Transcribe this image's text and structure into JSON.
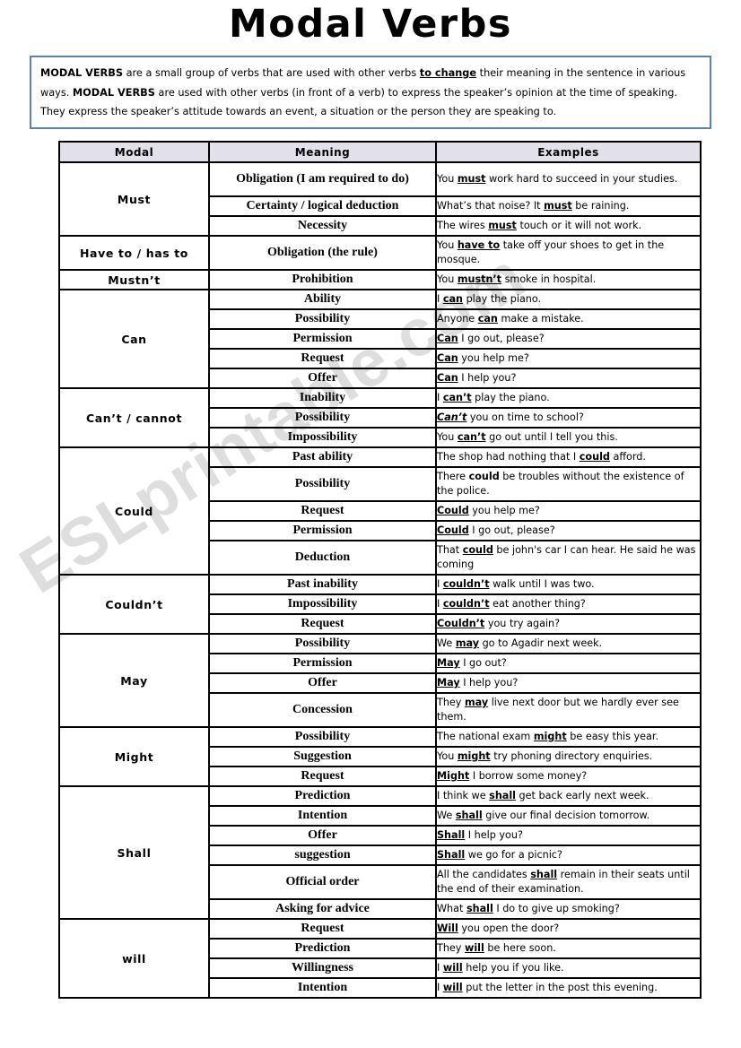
{
  "title": "Modal Verbs",
  "watermark": "ESLprintable.com",
  "intro": {
    "segments": [
      {
        "text": "MODAL VERBS",
        "style": "bold"
      },
      {
        "text": " are a small group of verbs that are used with other verbs ",
        "style": "normal"
      },
      {
        "text": "to change",
        "style": "bold-underline"
      },
      {
        "text": " their meaning in the sentence in various ways. ",
        "style": "normal"
      },
      {
        "text": "MODAL VERBS",
        "style": "bold"
      },
      {
        "text": " are used with other verbs (in front of a verb) to express the speaker’s opinion at the time of speaking. They express the speaker’s attitude towards an event, a situation or the person they are speaking to.",
        "style": "normal"
      }
    ],
    "border_color": "#5b82ab"
  },
  "table": {
    "header_bg": "#e2e0e9",
    "columns": [
      "Modal",
      "Meaning",
      "Examples"
    ],
    "groups": [
      {
        "modal": "Must",
        "rows": [
          {
            "meaning": "Obligation (I am required to do)",
            "example": [
              {
                "text": "You ",
                "style": "normal"
              },
              {
                "text": "must",
                "style": "bold-underline"
              },
              {
                "text": " work hard to succeed in your studies.",
                "style": "normal"
              }
            ],
            "lines": 2
          },
          {
            "meaning": "Certainty    /  logical deduction",
            "example": [
              {
                "text": "What’s that noise? It ",
                "style": "normal"
              },
              {
                "text": "must",
                "style": "bold-underline"
              },
              {
                "text": " be raining.",
                "style": "normal"
              }
            ],
            "lines": 1
          },
          {
            "meaning": "Necessity",
            "example": [
              {
                "text": "The wires ",
                "style": "normal"
              },
              {
                "text": "must",
                "style": "bold-underline"
              },
              {
                "text": " touch or it will not work.",
                "style": "normal"
              }
            ],
            "lines": 1
          }
        ]
      },
      {
        "modal": "Have to / has to",
        "rows": [
          {
            "meaning": "Obligation (the rule)",
            "example": [
              {
                "text": "You ",
                "style": "normal"
              },
              {
                "text": "have to",
                "style": "bold-underline"
              },
              {
                "text": " take off your shoes to get in the mosque.",
                "style": "normal"
              }
            ],
            "lines": 2
          }
        ]
      },
      {
        "modal": "Mustn’t",
        "rows": [
          {
            "meaning": "Prohibition",
            "example": [
              {
                "text": "You ",
                "style": "normal"
              },
              {
                "text": "mustn’t",
                "style": "bold-underline"
              },
              {
                "text": " smoke in hospital.",
                "style": "normal"
              }
            ],
            "lines": 1
          }
        ]
      },
      {
        "modal": "Can",
        "rows": [
          {
            "meaning": "Ability",
            "example": [
              {
                "text": "I ",
                "style": "normal"
              },
              {
                "text": "can",
                "style": "bold-underline"
              },
              {
                "text": " play the piano.",
                "style": "normal"
              }
            ],
            "lines": 1
          },
          {
            "meaning": "Possibility",
            "example": [
              {
                "text": "Anyone ",
                "style": "normal"
              },
              {
                "text": "can",
                "style": "bold-underline"
              },
              {
                "text": " make a mistake.",
                "style": "normal"
              }
            ],
            "lines": 1
          },
          {
            "meaning": "Permission",
            "example": [
              {
                "text": "Can",
                "style": "bold-underline"
              },
              {
                "text": " I go out, please?",
                "style": "normal"
              }
            ],
            "lines": 1
          },
          {
            "meaning": "Request",
            "example": [
              {
                "text": "Can",
                "style": "bold-underline"
              },
              {
                "text": " you help me?",
                "style": "normal"
              }
            ],
            "lines": 1
          },
          {
            "meaning": "Offer",
            "example": [
              {
                "text": "Can",
                "style": "bold-underline"
              },
              {
                "text": " I help you?",
                "style": "normal"
              }
            ],
            "lines": 1
          }
        ]
      },
      {
        "modal": "Can’t / cannot",
        "rows": [
          {
            "meaning": "Inability",
            "example": [
              {
                "text": "I ",
                "style": "normal"
              },
              {
                "text": "can’t",
                "style": "bold-underline"
              },
              {
                "text": " play the piano.",
                "style": "normal"
              }
            ],
            "lines": 1
          },
          {
            "meaning": "Possibility",
            "example": [
              {
                "text": "Can’t",
                "style": "bold-italic-underline"
              },
              {
                "text": " you on time to school?",
                "style": "normal"
              }
            ],
            "lines": 1
          },
          {
            "meaning": "Impossibility",
            "example": [
              {
                "text": "You ",
                "style": "normal"
              },
              {
                "text": "can’t",
                "style": "bold-underline"
              },
              {
                "text": " go out until I tell you this.",
                "style": "normal"
              }
            ],
            "lines": 1
          }
        ]
      },
      {
        "modal": "Could",
        "rows": [
          {
            "meaning": "Past ability",
            "example": [
              {
                "text": "The shop had nothing that I ",
                "style": "normal"
              },
              {
                "text": "could",
                "style": "bold-underline"
              },
              {
                "text": " afford.",
                "style": "normal"
              }
            ],
            "lines": 1
          },
          {
            "meaning": "Possibility",
            "example": [
              {
                "text": "There ",
                "style": "normal"
              },
              {
                "text": "could",
                "style": "bold"
              },
              {
                "text": " be troubles without the existence of the police.",
                "style": "normal"
              }
            ],
            "lines": 2
          },
          {
            "meaning": "Request",
            "example": [
              {
                "text": "Could",
                "style": "bold-underline"
              },
              {
                "text": " you help me?",
                "style": "normal"
              }
            ],
            "lines": 1
          },
          {
            "meaning": "Permission",
            "example": [
              {
                "text": "Could",
                "style": "bold-underline"
              },
              {
                "text": " I go out, please?",
                "style": "normal"
              }
            ],
            "lines": 1
          },
          {
            "meaning": "Deduction",
            "example": [
              {
                "text": "That ",
                "style": "normal"
              },
              {
                "text": "could",
                "style": "bold-underline"
              },
              {
                "text": " be john's car I can hear. He said he was coming",
                "style": "normal"
              }
            ],
            "lines": 2
          }
        ]
      },
      {
        "modal": "Couldn’t",
        "rows": [
          {
            "meaning": "Past inability",
            "example": [
              {
                "text": "I ",
                "style": "normal"
              },
              {
                "text": "couldn’t",
                "style": "bold-underline"
              },
              {
                "text": " walk until I was two.",
                "style": "normal"
              }
            ],
            "lines": 1
          },
          {
            "meaning": "Impossibility",
            "example": [
              {
                "text": "I ",
                "style": "normal"
              },
              {
                "text": "couldn’t",
                "style": "bold-underline"
              },
              {
                "text": " eat another thing?",
                "style": "normal"
              }
            ],
            "lines": 1
          },
          {
            "meaning": "Request",
            "example": [
              {
                "text": "Couldn’t",
                "style": "bold-underline"
              },
              {
                "text": " you try again?",
                "style": "normal"
              }
            ],
            "lines": 1
          }
        ]
      },
      {
        "modal": "May",
        "rows": [
          {
            "meaning": "Possibility",
            "example": [
              {
                "text": "We ",
                "style": "normal"
              },
              {
                "text": "may",
                "style": "bold-underline"
              },
              {
                "text": " go to Agadir next week.",
                "style": "normal"
              }
            ],
            "lines": 1
          },
          {
            "meaning": "Permission",
            "example": [
              {
                "text": "May",
                "style": "bold-underline"
              },
              {
                "text": " I go out?",
                "style": "normal"
              }
            ],
            "lines": 1
          },
          {
            "meaning": "Offer",
            "example": [
              {
                "text": "May",
                "style": "bold-underline"
              },
              {
                "text": " I help you?",
                "style": "normal"
              }
            ],
            "lines": 1
          },
          {
            "meaning": "Concession",
            "example": [
              {
                "text": "They ",
                "style": "normal"
              },
              {
                "text": "may",
                "style": "bold-underline"
              },
              {
                "text": " live next door but we hardly ever see them.",
                "style": "normal"
              }
            ],
            "lines": 2
          }
        ]
      },
      {
        "modal": "Might",
        "rows": [
          {
            "meaning": "Possibility",
            "example": [
              {
                "text": "The national exam ",
                "style": "normal"
              },
              {
                "text": "might",
                "style": "bold-underline"
              },
              {
                "text": " be easy this year.",
                "style": "normal"
              }
            ],
            "lines": 1
          },
          {
            "meaning": "Suggestion",
            "example": [
              {
                "text": "You ",
                "style": "normal"
              },
              {
                "text": "might",
                "style": "bold-underline"
              },
              {
                "text": " try phoning directory enquiries.",
                "style": "normal"
              }
            ],
            "lines": 1
          },
          {
            "meaning": "Request",
            "example": [
              {
                "text": "Might",
                "style": "bold-underline"
              },
              {
                "text": " I borrow some money?",
                "style": "normal"
              }
            ],
            "lines": 1
          }
        ]
      },
      {
        "modal": "Shall",
        "rows": [
          {
            "meaning": "Prediction",
            "example": [
              {
                "text": "I think we ",
                "style": "normal"
              },
              {
                "text": "shall",
                "style": "bold-underline"
              },
              {
                "text": " get back early next week.",
                "style": "normal"
              }
            ],
            "lines": 1
          },
          {
            "meaning": "Intention",
            "example": [
              {
                "text": "We ",
                "style": "normal"
              },
              {
                "text": "shall",
                "style": "bold-underline"
              },
              {
                "text": " give our final decision tomorrow.",
                "style": "normal"
              }
            ],
            "lines": 1
          },
          {
            "meaning": "Offer",
            "example": [
              {
                "text": "Shall",
                "style": "bold-underline"
              },
              {
                "text": " I help you?",
                "style": "normal"
              }
            ],
            "lines": 1
          },
          {
            "meaning": "suggestion",
            "example": [
              {
                "text": "Shall",
                "style": "bold-underline"
              },
              {
                "text": " we go for a picnic?",
                "style": "normal"
              }
            ],
            "lines": 1
          },
          {
            "meaning": "Official order",
            "example": [
              {
                "text": "All the candidates ",
                "style": "normal"
              },
              {
                "text": "shall",
                "style": "bold-underline"
              },
              {
                "text": " remain in their seats until the end of their examination.",
                "style": "normal"
              }
            ],
            "lines": 2
          },
          {
            "meaning": "Asking for advice",
            "example": [
              {
                "text": "What ",
                "style": "normal"
              },
              {
                "text": "shall",
                "style": "bold-underline"
              },
              {
                "text": " I do to give up smoking?",
                "style": "normal"
              }
            ],
            "lines": 1
          }
        ]
      },
      {
        "modal": "will",
        "rows": [
          {
            "meaning": "Request",
            "example": [
              {
                "text": "Will",
                "style": "bold-underline"
              },
              {
                "text": " you open the door?",
                "style": "normal"
              }
            ],
            "lines": 1
          },
          {
            "meaning": "Prediction",
            "example": [
              {
                "text": "They ",
                "style": "normal"
              },
              {
                "text": "will",
                "style": "bold-underline"
              },
              {
                "text": " be here soon.",
                "style": "normal"
              }
            ],
            "lines": 1
          },
          {
            "meaning": "Willingness",
            "example": [
              {
                "text": "I ",
                "style": "normal"
              },
              {
                "text": "will",
                "style": "bold-underline"
              },
              {
                "text": " help you if you like.",
                "style": "normal"
              }
            ],
            "lines": 1
          },
          {
            "meaning": "Intention",
            "example": [
              {
                "text": "I ",
                "style": "normal"
              },
              {
                "text": "will",
                "style": "bold-underline"
              },
              {
                "text": " put the letter in the post this evening.",
                "style": "normal"
              }
            ],
            "lines": 1
          }
        ]
      }
    ]
  }
}
